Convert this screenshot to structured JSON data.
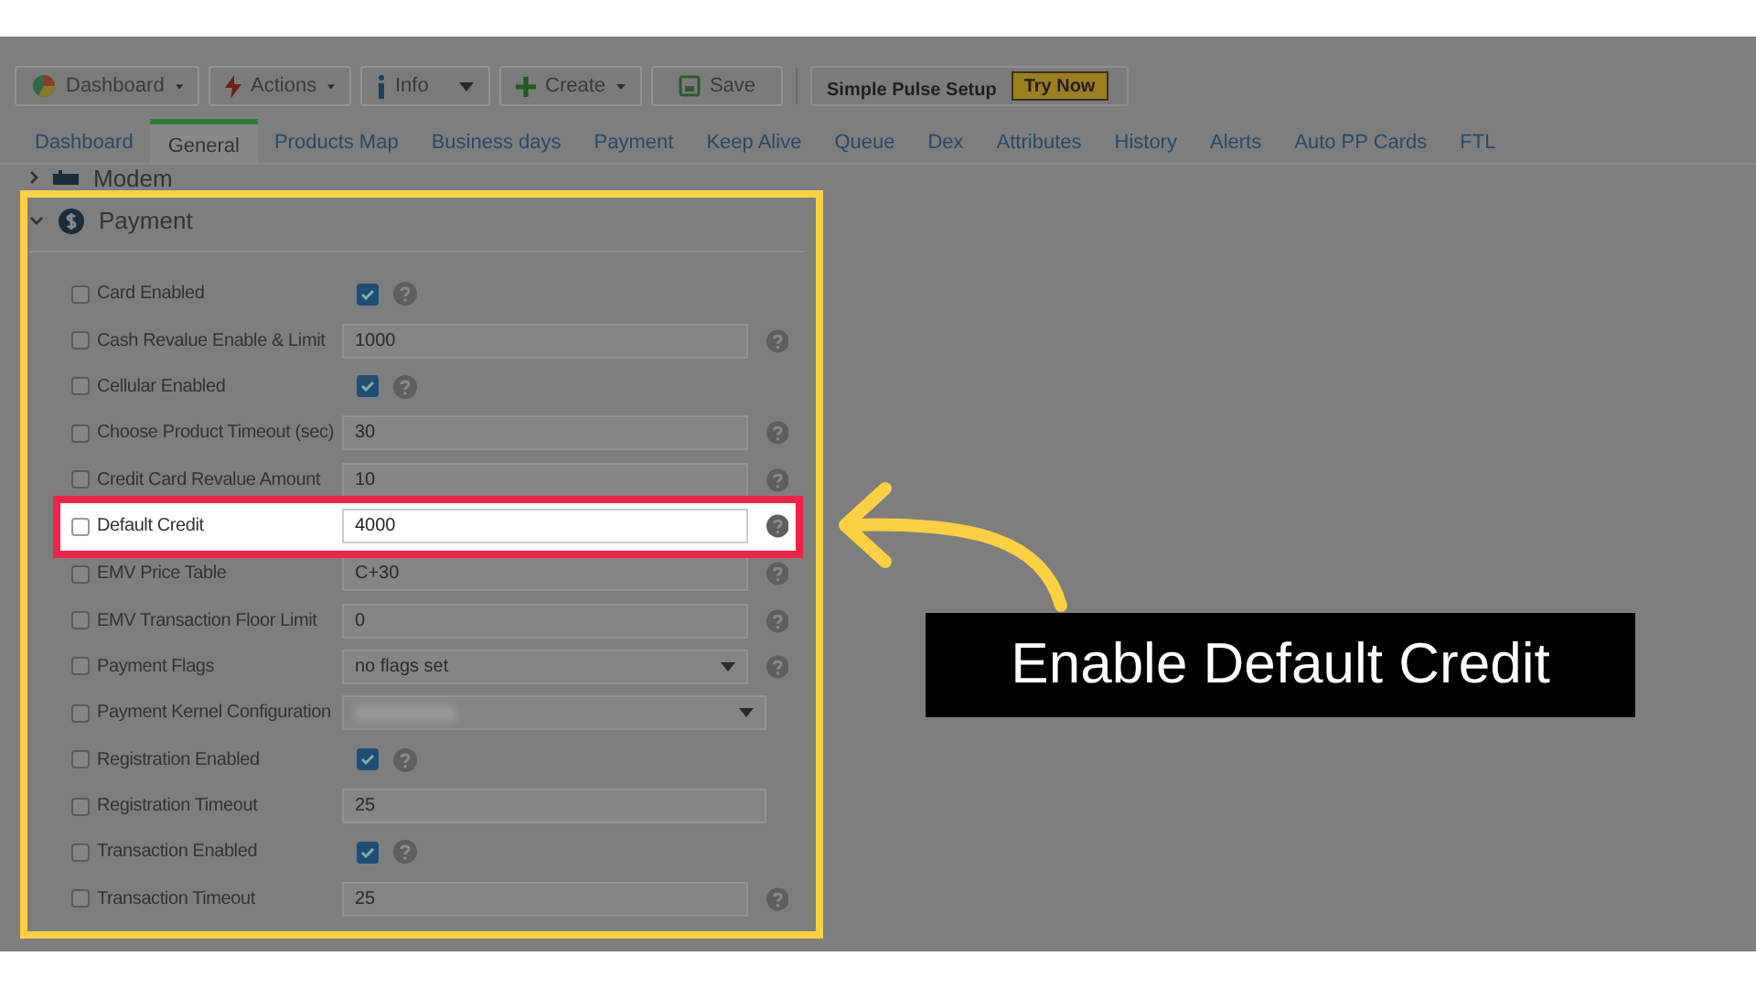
{
  "toolbar": [
    {
      "label": "Dashboard",
      "dropdown": true
    },
    {
      "label": "Actions",
      "dropdown": true
    },
    {
      "label": "Info",
      "dropdown": true
    },
    {
      "label": "Create",
      "dropdown": true
    },
    {
      "label": "Save",
      "dropdown": false
    }
  ],
  "promo": {
    "title": "Simple Pulse Setup",
    "button": "Try Now"
  },
  "tabs": [
    {
      "label": "Dashboard",
      "selected": false
    },
    {
      "label": "General",
      "selected": true
    },
    {
      "label": "Products Map",
      "selected": false
    },
    {
      "label": "Business days",
      "selected": false
    },
    {
      "label": "Payment",
      "selected": false
    },
    {
      "label": "Keep Alive",
      "selected": false
    },
    {
      "label": "Queue",
      "selected": false
    },
    {
      "label": "Dex",
      "selected": false
    },
    {
      "label": "Attributes",
      "selected": false
    },
    {
      "label": "History",
      "selected": false
    },
    {
      "label": "Alerts",
      "selected": false
    },
    {
      "label": "Auto PP Cards",
      "selected": false
    },
    {
      "label": "FTL",
      "selected": false
    }
  ],
  "sections": [
    {
      "title": "Modem",
      "expanded": false
    },
    {
      "title": "Payment",
      "expanded": true
    }
  ],
  "settings": [
    {
      "label": "Card Enabled",
      "override": false,
      "kind": "toggle",
      "checked": true,
      "help": true,
      "highlighted": false
    },
    {
      "label": "Cash Revalue Enable & Limit",
      "override": false,
      "kind": "text",
      "value": "1000",
      "help": true,
      "highlighted": false
    },
    {
      "label": "Cellular Enabled",
      "override": false,
      "kind": "toggle",
      "checked": true,
      "help": true,
      "highlighted": false
    },
    {
      "label": "Choose Product Timeout (sec)",
      "override": false,
      "kind": "text",
      "value": "30",
      "help": true,
      "highlighted": false
    },
    {
      "label": "Credit Card Revalue Amount",
      "override": false,
      "kind": "text",
      "value": "10",
      "help": true,
      "highlighted": false
    },
    {
      "label": "Default Credit",
      "override": false,
      "kind": "text",
      "value": "4000",
      "help": true,
      "highlighted": true
    },
    {
      "label": "EMV Price Table",
      "override": false,
      "kind": "text",
      "value": "C+30",
      "help": true,
      "highlighted": false
    },
    {
      "label": "EMV Transaction Floor Limit",
      "override": false,
      "kind": "text",
      "value": "0",
      "help": true,
      "highlighted": false
    },
    {
      "label": "Payment Flags",
      "override": false,
      "kind": "select",
      "value": "no flags set",
      "help": true,
      "highlighted": false
    },
    {
      "label": "Payment Kernel Configuration",
      "override": false,
      "kind": "select-blurred",
      "help": false,
      "highlighted": false
    },
    {
      "label": "Registration Enabled",
      "override": false,
      "kind": "toggle",
      "checked": true,
      "help": true,
      "highlighted": false
    },
    {
      "label": "Registration Timeout",
      "override": false,
      "kind": "text",
      "value": "25",
      "help": false,
      "highlighted": false
    },
    {
      "label": "Transaction Enabled",
      "override": false,
      "kind": "toggle",
      "checked": true,
      "help": true,
      "highlighted": false
    },
    {
      "label": "Transaction Timeout",
      "override": false,
      "kind": "text",
      "value": "25",
      "help": true,
      "highlighted": false
    }
  ],
  "callout": "Enable Default Credit"
}
